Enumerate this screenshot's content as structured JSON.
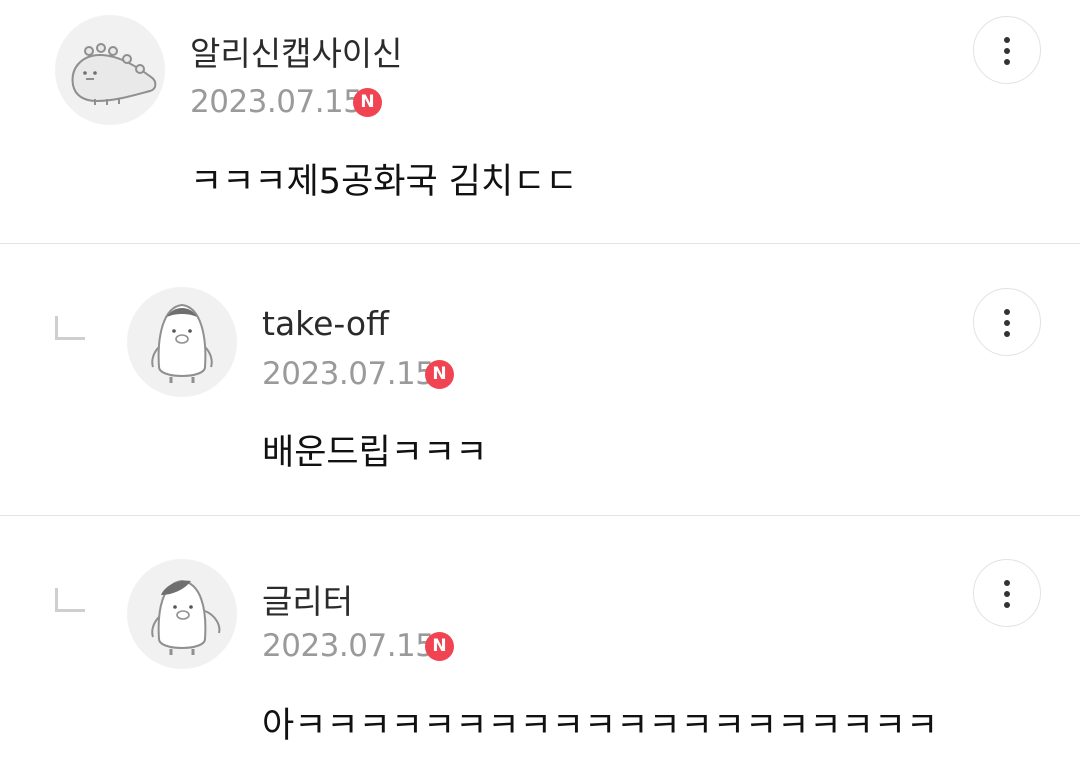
{
  "comments": [
    {
      "username": "알리신캡사이신",
      "date": "2023.07.15",
      "badge": "N",
      "text": "ㅋㅋㅋ제5공화국 김치ㄷㄷ",
      "avatar_icon": "dinosaur-avatar-icon",
      "is_reply": false
    },
    {
      "username": "take-off",
      "date": "2023.07.15",
      "badge": "N",
      "text": "배운드립ㅋㅋㅋ",
      "avatar_icon": "penguin-avatar-icon",
      "is_reply": true
    },
    {
      "username": "글리터",
      "date": "2023.07.15",
      "badge": "N",
      "text": "아ㅋㅋㅋㅋㅋㅋㅋㅋㅋㅋㅋㅋㅋㅋㅋㅋㅋㅋㅋㅋ",
      "avatar_icon": "penguin-avatar-icon",
      "is_reply": true
    }
  ],
  "colors": {
    "badge": "#f04452",
    "divider": "#e4e4e4",
    "date": "#9a9a9a"
  },
  "icons": {
    "more": "more-vertical-icon",
    "reply": "reply-arrow-icon"
  }
}
